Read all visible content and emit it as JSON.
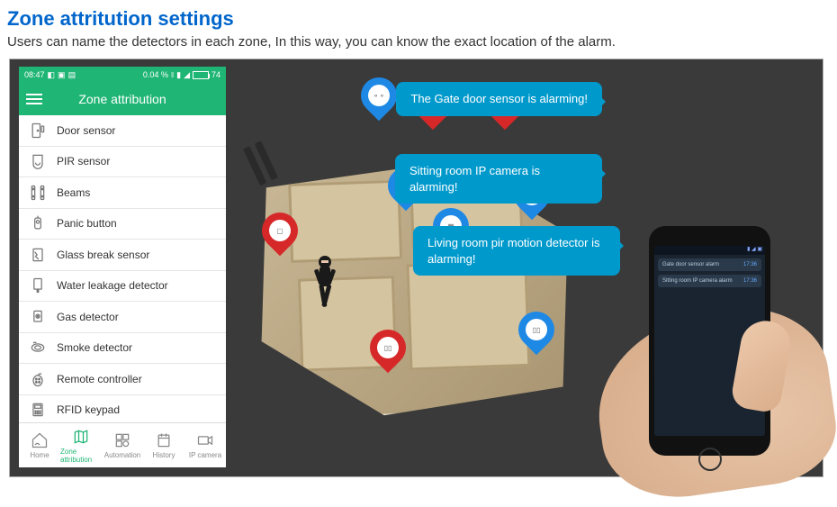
{
  "header": {
    "title": "Zone attritution settings",
    "subtitle": "Users can name the detectors in each zone, In this way, you can know the exact location of the alarm."
  },
  "phone_left": {
    "status": {
      "time": "08:47",
      "percent_text": "0.04 %",
      "battery": "74"
    },
    "app_title": "Zone attribution",
    "zones": [
      {
        "label": "Door sensor",
        "icon": "door-sensor-icon"
      },
      {
        "label": "PIR sensor",
        "icon": "pir-sensor-icon"
      },
      {
        "label": "Beams",
        "icon": "beams-icon"
      },
      {
        "label": "Panic button",
        "icon": "panic-button-icon"
      },
      {
        "label": "Glass break sensor",
        "icon": "glass-break-icon"
      },
      {
        "label": "Water leakage detector",
        "icon": "water-leak-icon"
      },
      {
        "label": "Gas detector",
        "icon": "gas-detector-icon"
      },
      {
        "label": "Smoke detector",
        "icon": "smoke-detector-icon"
      },
      {
        "label": "Remote controller",
        "icon": "remote-controller-icon"
      },
      {
        "label": "RFID keypad",
        "icon": "rfid-keypad-icon"
      }
    ],
    "nav": [
      {
        "label": "Home",
        "active": false
      },
      {
        "label": "Zone attribution",
        "active": true
      },
      {
        "label": "Automation",
        "active": false
      },
      {
        "label": "History",
        "active": false
      },
      {
        "label": "IP camera",
        "active": false
      }
    ]
  },
  "bubbles": [
    "The Gate door sensor is alarming!",
    "Sitting room IP camera is alarming!",
    "Living room pir motion detector is alarming!"
  ],
  "phone_right": {
    "messages": [
      {
        "text": "Gate door sensor alarm",
        "time": "17:36"
      },
      {
        "text": "Sitting room IP camera alarm",
        "time": "17:36"
      }
    ]
  },
  "colors": {
    "brand_green": "#1fb574",
    "accent_blue": "#0099cc",
    "marker_red": "#d62828",
    "marker_blue": "#1e88e5"
  }
}
